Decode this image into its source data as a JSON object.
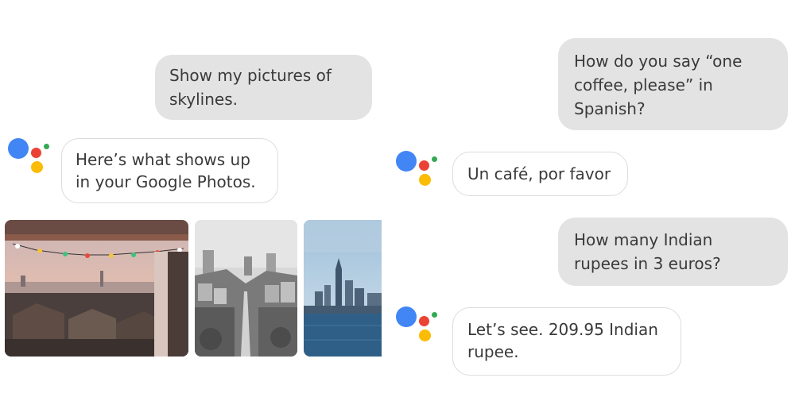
{
  "colors": {
    "user_bubble": "#e3e3e3",
    "assistant_bubble_border": "#dcdcdc",
    "logo_blue": "#4285f4",
    "logo_red": "#ea4335",
    "logo_yellow": "#fbbc05",
    "logo_green": "#34a853"
  },
  "left_chat": {
    "user_message": "Show my pictures of skylines.",
    "assistant_message": "Here’s what shows up in your Google Photos.",
    "photos": [
      "city-sunset-patio-photo",
      "hilly-street-photo",
      "bay-skyline-photo"
    ]
  },
  "right_chat": {
    "messages": [
      {
        "role": "user",
        "text": "How do you say “one coffee, please” in Spanish?"
      },
      {
        "role": "assistant",
        "text": "Un café, por favor"
      },
      {
        "role": "user",
        "text": "How many Indian rupees in 3 euros?"
      },
      {
        "role": "assistant",
        "text": "Let’s see. 209.95 Indian rupee."
      }
    ]
  }
}
